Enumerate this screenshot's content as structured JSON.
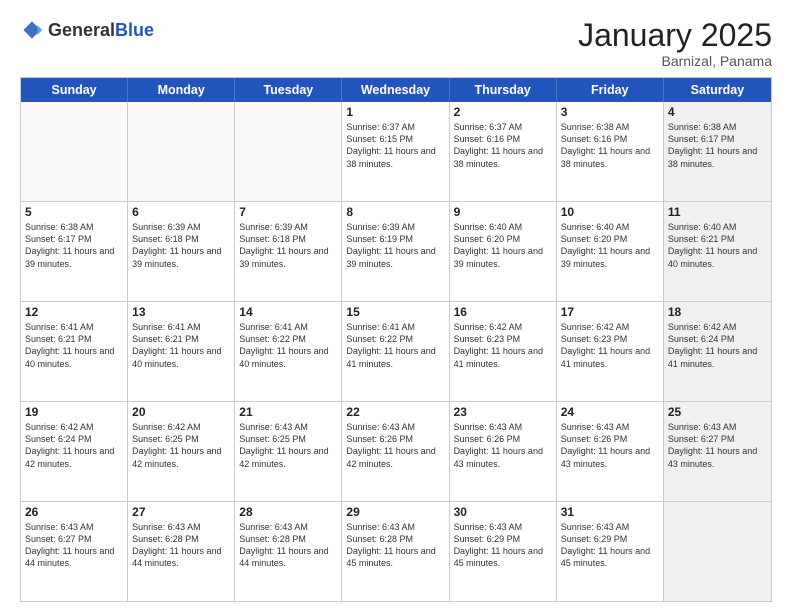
{
  "logo": {
    "general": "General",
    "blue": "Blue"
  },
  "header": {
    "month": "January 2025",
    "location": "Barnizal, Panama"
  },
  "days_of_week": [
    "Sunday",
    "Monday",
    "Tuesday",
    "Wednesday",
    "Thursday",
    "Friday",
    "Saturday"
  ],
  "weeks": [
    [
      {
        "day": "",
        "info": "",
        "empty": true
      },
      {
        "day": "",
        "info": "",
        "empty": true
      },
      {
        "day": "",
        "info": "",
        "empty": true
      },
      {
        "day": "1",
        "info": "Sunrise: 6:37 AM\nSunset: 6:15 PM\nDaylight: 11 hours\nand 38 minutes."
      },
      {
        "day": "2",
        "info": "Sunrise: 6:37 AM\nSunset: 6:16 PM\nDaylight: 11 hours\nand 38 minutes."
      },
      {
        "day": "3",
        "info": "Sunrise: 6:38 AM\nSunset: 6:16 PM\nDaylight: 11 hours\nand 38 minutes."
      },
      {
        "day": "4",
        "info": "Sunrise: 6:38 AM\nSunset: 6:17 PM\nDaylight: 11 hours\nand 38 minutes.",
        "shaded": true
      }
    ],
    [
      {
        "day": "5",
        "info": "Sunrise: 6:38 AM\nSunset: 6:17 PM\nDaylight: 11 hours\nand 39 minutes."
      },
      {
        "day": "6",
        "info": "Sunrise: 6:39 AM\nSunset: 6:18 PM\nDaylight: 11 hours\nand 39 minutes."
      },
      {
        "day": "7",
        "info": "Sunrise: 6:39 AM\nSunset: 6:18 PM\nDaylight: 11 hours\nand 39 minutes."
      },
      {
        "day": "8",
        "info": "Sunrise: 6:39 AM\nSunset: 6:19 PM\nDaylight: 11 hours\nand 39 minutes."
      },
      {
        "day": "9",
        "info": "Sunrise: 6:40 AM\nSunset: 6:20 PM\nDaylight: 11 hours\nand 39 minutes."
      },
      {
        "day": "10",
        "info": "Sunrise: 6:40 AM\nSunset: 6:20 PM\nDaylight: 11 hours\nand 39 minutes."
      },
      {
        "day": "11",
        "info": "Sunrise: 6:40 AM\nSunset: 6:21 PM\nDaylight: 11 hours\nand 40 minutes.",
        "shaded": true
      }
    ],
    [
      {
        "day": "12",
        "info": "Sunrise: 6:41 AM\nSunset: 6:21 PM\nDaylight: 11 hours\nand 40 minutes."
      },
      {
        "day": "13",
        "info": "Sunrise: 6:41 AM\nSunset: 6:21 PM\nDaylight: 11 hours\nand 40 minutes."
      },
      {
        "day": "14",
        "info": "Sunrise: 6:41 AM\nSunset: 6:22 PM\nDaylight: 11 hours\nand 40 minutes."
      },
      {
        "day": "15",
        "info": "Sunrise: 6:41 AM\nSunset: 6:22 PM\nDaylight: 11 hours\nand 41 minutes."
      },
      {
        "day": "16",
        "info": "Sunrise: 6:42 AM\nSunset: 6:23 PM\nDaylight: 11 hours\nand 41 minutes."
      },
      {
        "day": "17",
        "info": "Sunrise: 6:42 AM\nSunset: 6:23 PM\nDaylight: 11 hours\nand 41 minutes."
      },
      {
        "day": "18",
        "info": "Sunrise: 6:42 AM\nSunset: 6:24 PM\nDaylight: 11 hours\nand 41 minutes.",
        "shaded": true
      }
    ],
    [
      {
        "day": "19",
        "info": "Sunrise: 6:42 AM\nSunset: 6:24 PM\nDaylight: 11 hours\nand 42 minutes."
      },
      {
        "day": "20",
        "info": "Sunrise: 6:42 AM\nSunset: 6:25 PM\nDaylight: 11 hours\nand 42 minutes."
      },
      {
        "day": "21",
        "info": "Sunrise: 6:43 AM\nSunset: 6:25 PM\nDaylight: 11 hours\nand 42 minutes."
      },
      {
        "day": "22",
        "info": "Sunrise: 6:43 AM\nSunset: 6:26 PM\nDaylight: 11 hours\nand 42 minutes."
      },
      {
        "day": "23",
        "info": "Sunrise: 6:43 AM\nSunset: 6:26 PM\nDaylight: 11 hours\nand 43 minutes."
      },
      {
        "day": "24",
        "info": "Sunrise: 6:43 AM\nSunset: 6:26 PM\nDaylight: 11 hours\nand 43 minutes."
      },
      {
        "day": "25",
        "info": "Sunrise: 6:43 AM\nSunset: 6:27 PM\nDaylight: 11 hours\nand 43 minutes.",
        "shaded": true
      }
    ],
    [
      {
        "day": "26",
        "info": "Sunrise: 6:43 AM\nSunset: 6:27 PM\nDaylight: 11 hours\nand 44 minutes."
      },
      {
        "day": "27",
        "info": "Sunrise: 6:43 AM\nSunset: 6:28 PM\nDaylight: 11 hours\nand 44 minutes."
      },
      {
        "day": "28",
        "info": "Sunrise: 6:43 AM\nSunset: 6:28 PM\nDaylight: 11 hours\nand 44 minutes."
      },
      {
        "day": "29",
        "info": "Sunrise: 6:43 AM\nSunset: 6:28 PM\nDaylight: 11 hours\nand 45 minutes."
      },
      {
        "day": "30",
        "info": "Sunrise: 6:43 AM\nSunset: 6:29 PM\nDaylight: 11 hours\nand 45 minutes."
      },
      {
        "day": "31",
        "info": "Sunrise: 6:43 AM\nSunset: 6:29 PM\nDaylight: 11 hours\nand 45 minutes."
      },
      {
        "day": "",
        "info": "",
        "empty": true,
        "shaded": true
      }
    ]
  ]
}
